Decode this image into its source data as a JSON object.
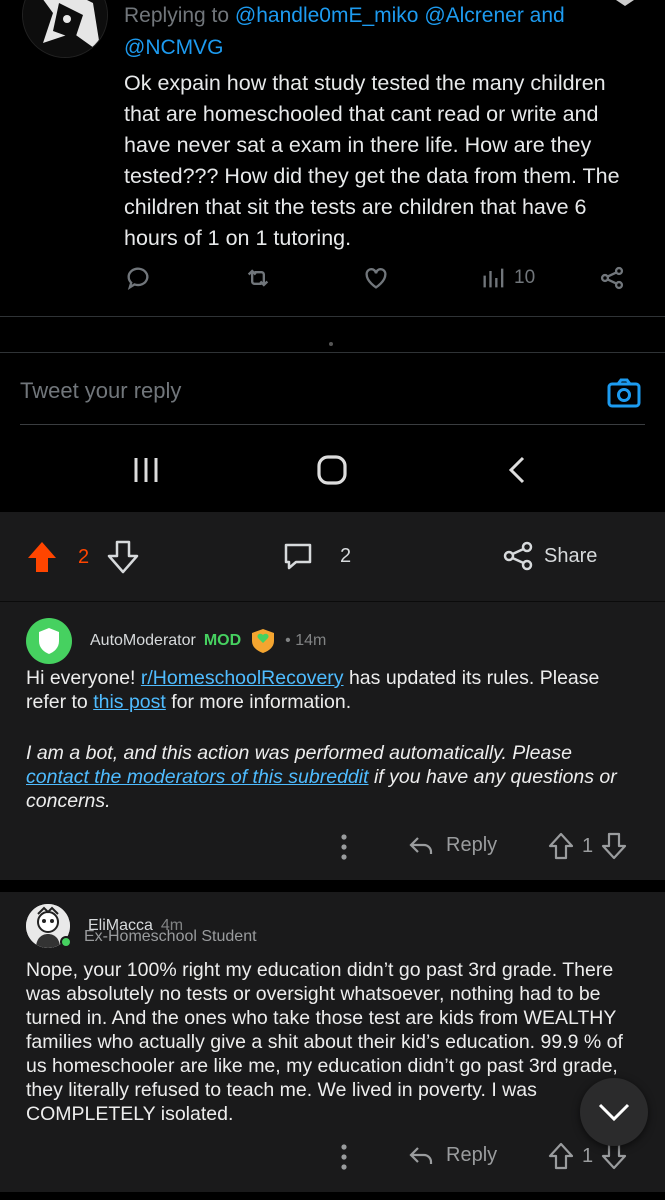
{
  "tweet": {
    "replying_prefix": "Replying to ",
    "replying_handles": "@handle0mE_miko @Alcrener and",
    "handle": "@NCMVG",
    "body": "Ok expain how that study tested the many children that are homeschooled that cant read or write and have never sat a exam in there life. How are they tested??? How did they get the data from them. The children that sit the tests are children that have 6 hours of 1 on 1 tutoring.",
    "views": "10",
    "reply_placeholder": "Tweet your reply"
  },
  "post_bar": {
    "upvotes": "2",
    "comments": "2",
    "share_label": "Share",
    "accent": "#ff4500"
  },
  "comments": [
    {
      "author": "AutoModerator",
      "mod_tag": "MOD",
      "time": "• 14m",
      "text_before_link": "Hi everyone! ",
      "link1": "r/HomeschoolRecovery",
      "text_mid": " has updated its rules. Please refer to ",
      "link2": "this post",
      "text_after": " for more information.",
      "bot_before": "I am a bot, and this action was performed automatically. Please ",
      "bot_link": "contact the moderators of this subreddit",
      "bot_after": " if you have any questions or concerns.",
      "reply_label": "Reply",
      "score": "1"
    },
    {
      "author": "EliMacca",
      "time": "4m",
      "flair": "Ex-Homeschool Student",
      "text": "Nope, your 100% right my education didn’t go past 3rd grade. There was absolutely no tests or oversight whatsoever, nothing had to be turned in. And the ones who take those test are kids from  WEALTHY families who actually give a shit about their kid’s education.  99.9 % of us homeschooler are like me, my education didn’t go past 3rd grade, they literally refused to teach me. We lived in poverty. I was COMPLETELY isolated.",
      "reply_label": "Reply",
      "score": "1"
    }
  ]
}
